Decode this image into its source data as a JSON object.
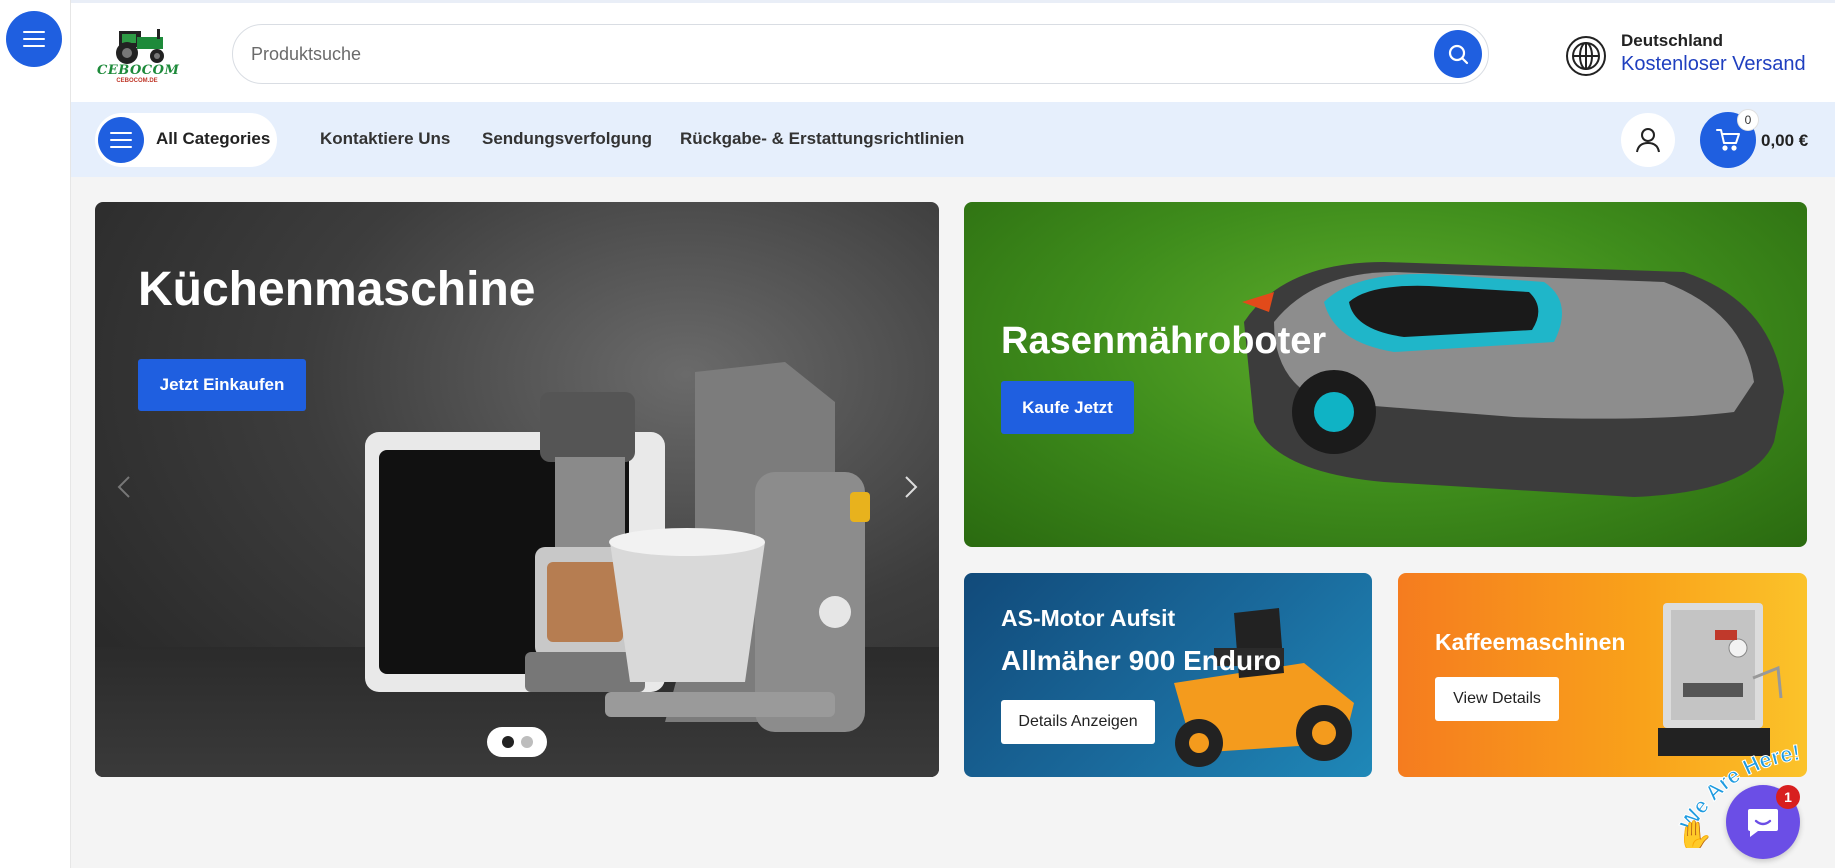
{
  "header": {
    "logo_text": "CEBOCOM",
    "logo_subtext": "CEBOCOM.DE",
    "search_placeholder": "Produktsuche",
    "shipping_country": "Deutschland",
    "shipping_label": "Kostenloser Versand"
  },
  "nav": {
    "categories_label": "All Categories",
    "links": [
      "Kontaktiere Uns",
      "Sendungsverfolgung",
      "Rückgabe- & Erstattungsrichtlinien"
    ],
    "cart_count": "0",
    "cart_total": "0,00 €"
  },
  "slider": {
    "title": "Küchenmaschine",
    "button": "Jetzt Einkaufen",
    "slides_total": 2,
    "active_slide": 1
  },
  "banners": {
    "mower": {
      "title": "Rasenmähroboter",
      "button": "Kaufe Jetzt"
    },
    "as_motor": {
      "title_line1": "AS-Motor Aufsit",
      "title_line2": "Allmäher 900 Enduro",
      "button": "Details Anzeigen"
    },
    "coffee": {
      "title": "Kaffeemaschinen",
      "button": "View Details"
    }
  },
  "chat": {
    "tag": "We Are Here!",
    "badge": "1"
  },
  "colors": {
    "accent": "#1f5fe0",
    "navbar_bg": "#e6effc",
    "link_blue": "#1f3fbf",
    "chat": "#6b4ee6"
  },
  "icons": [
    "menu-icon",
    "tractor-logo",
    "search-icon",
    "globe-icon",
    "user-icon",
    "cart-icon",
    "chevron-left-icon",
    "chevron-right-icon",
    "chat-icon",
    "wave-hand-icon"
  ]
}
